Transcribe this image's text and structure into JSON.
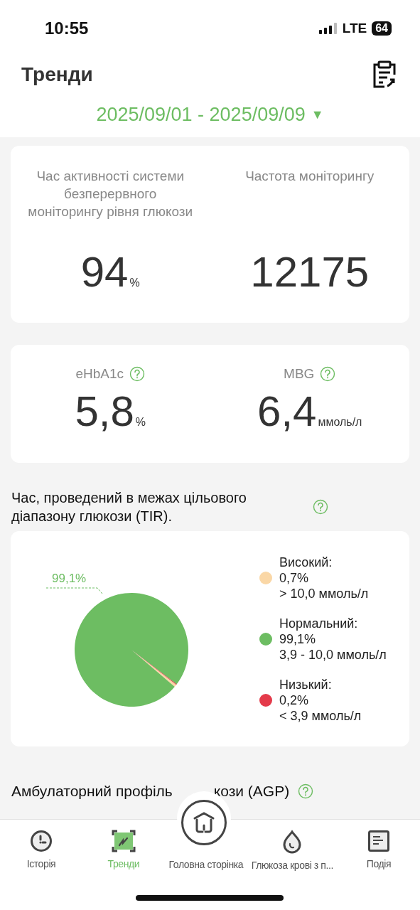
{
  "status_bar": {
    "time": "10:55",
    "network": "LTE",
    "battery": "64"
  },
  "header": {
    "title": "Тренди",
    "date_range": "2025/09/01 - 2025/09/09",
    "dropdown_glyph": "▼"
  },
  "activity_card": {
    "stats": [
      {
        "label": "Час активності системи безперервного моніторингу рівня глюкози",
        "value": "94",
        "unit": "%"
      },
      {
        "label": "Частота моніторингу",
        "value": "12175"
      }
    ]
  },
  "glucose_card": {
    "stats": [
      {
        "label": "eHbA1c",
        "value": "5,8",
        "unit": "%"
      },
      {
        "label": "MBG",
        "value": "6,4",
        "unit": "ммоль/л"
      }
    ]
  },
  "tir": {
    "title": "Час, проведений в межах цільового діапазону глюкози (TIR).",
    "chart_data": {
      "type": "pie",
      "values": [
        0.7,
        99.1,
        0.2
      ],
      "annotations": [
        {
          "text": "99,1%"
        }
      ]
    },
    "legend": [
      {
        "label": "Високий:",
        "percent": "0,7%",
        "range": "> 10,0 ммоль/л",
        "color": "#fad7a6"
      },
      {
        "label": "Нормальний:",
        "percent": "99,1%",
        "range": "3,9 - 10,0 ммоль/л",
        "color": "#6dbd62"
      },
      {
        "label": "Низький:",
        "percent": "0,2%",
        "range": "< 3,9 ммоль/л",
        "color": "#e43a4a"
      }
    ]
  },
  "agp": {
    "title_parts": [
      "Амбулаторний профіль",
      "кози (AGP)"
    ]
  },
  "tab_bar": [
    {
      "kind": "history",
      "label": "Історія",
      "selected": false
    },
    {
      "kind": "trends",
      "label": "Тренди",
      "selected": true
    },
    {
      "kind": "home",
      "label": "Головна сторінка",
      "selected": false
    },
    {
      "kind": "drop",
      "label": "Глюкоза крові з п...",
      "selected": false
    },
    {
      "kind": "events",
      "label": "Подія",
      "selected": false
    }
  ]
}
